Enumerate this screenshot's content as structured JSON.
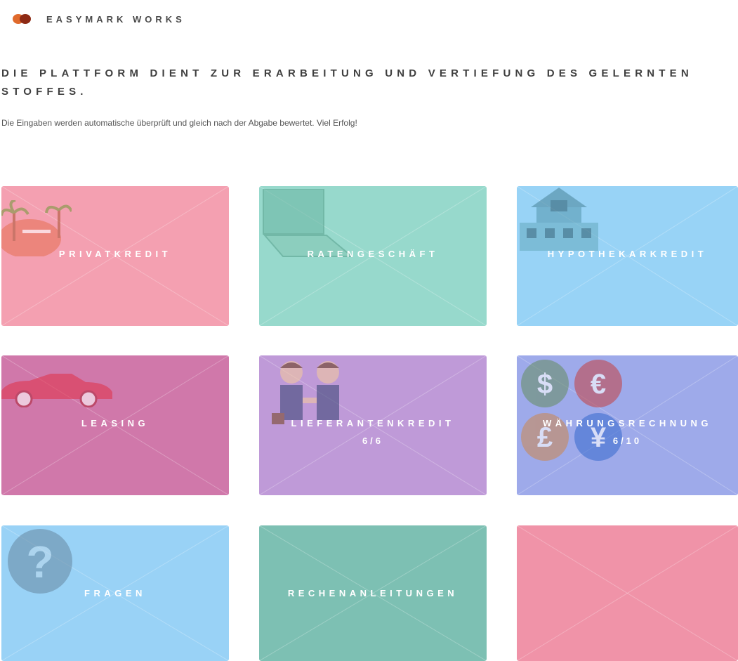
{
  "header": {
    "brand": "EASYMARK WORKS"
  },
  "intro": {
    "headline": "DIE PLATTFORM DIENT ZUR ERARBEITUNG UND VERTIEFUNG DES GELERNTEN STOFFES.",
    "subtext": "Die Eingaben werden automatische überprüft und gleich nach der Abgabe bewertet. Viel Erfolg!"
  },
  "tiles": [
    {
      "label": "PRIVATKREDIT",
      "icon": "beach-icon",
      "color": "#f4a0b1"
    },
    {
      "label": "RATENGESCHÄFT",
      "icon": "laptop-icon",
      "color": "#97d9cc"
    },
    {
      "label": "HYPOTHEKARKREDIT",
      "icon": "house-icon",
      "color": "#98d3f6"
    },
    {
      "label": "LEASING",
      "icon": "car-icon",
      "color": "#d078aa"
    },
    {
      "label": "LIEFERANTENKREDIT",
      "progress": "6/6",
      "icon": "handshake-icon",
      "color": "#bf9ad8"
    },
    {
      "label": "WÄHRUNGSRECHNUNG",
      "progress": "6/10",
      "icon": "currency-icon",
      "color": "#9eaaea"
    },
    {
      "label": "FRAGEN",
      "icon": "question-icon",
      "color": "#99d2f6"
    },
    {
      "label": "RECHENANLEITUNGEN",
      "color": "#7dc0b3"
    },
    {
      "label": "",
      "color": "#f093a8"
    }
  ]
}
